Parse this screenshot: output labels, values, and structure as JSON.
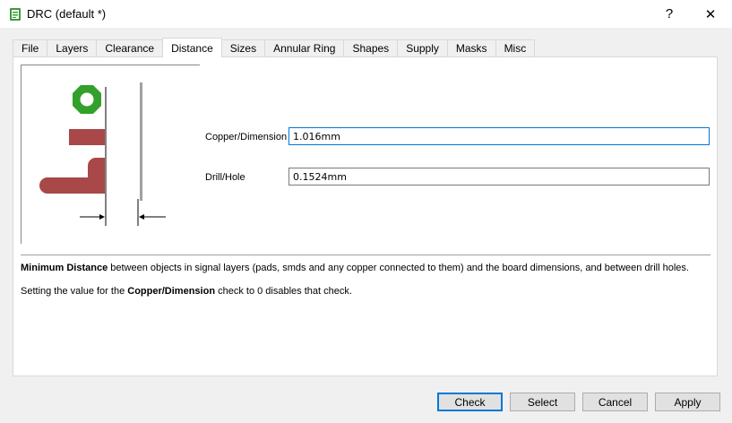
{
  "window": {
    "title": "DRC (default *)",
    "help_glyph": "?",
    "close_glyph": "✕"
  },
  "tabs": [
    {
      "label": "File"
    },
    {
      "label": "Layers"
    },
    {
      "label": "Clearance"
    },
    {
      "label": "Distance",
      "active": true
    },
    {
      "label": "Sizes"
    },
    {
      "label": "Annular Ring"
    },
    {
      "label": "Shapes"
    },
    {
      "label": "Supply"
    },
    {
      "label": "Masks"
    },
    {
      "label": "Misc"
    }
  ],
  "fields": {
    "copper_dimension": {
      "label": "Copper/Dimension",
      "value": "1.016mm"
    },
    "drill_hole": {
      "label": "Drill/Hole",
      "value": "0.1524mm"
    }
  },
  "description": {
    "line1_bold": "Minimum Distance",
    "line1_rest": " between objects in signal layers (pads, smds and any copper connected to them) and the board dimensions, and between drill holes.",
    "line2_pre": "Setting the value for the ",
    "line2_bold": "Copper/Dimension",
    "line2_post": " check to 0 disables that check."
  },
  "buttons": {
    "check": "Check",
    "select": "Select",
    "cancel": "Cancel",
    "apply": "Apply"
  },
  "colors": {
    "pad_green": "#33a02c",
    "copper_red": "#a84848",
    "dimension_gray": "#a0a0a0"
  },
  "icons": {
    "app": "drc-chip-icon",
    "preview": "distance-diagram-icon"
  }
}
